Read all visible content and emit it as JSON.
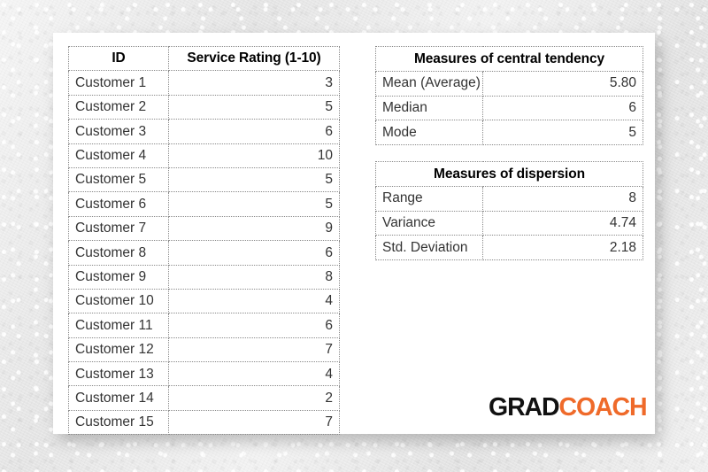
{
  "page": {
    "background_color": "#eaeaea",
    "card_color": "#ffffff"
  },
  "ratings_table": {
    "name": "service-ratings",
    "headers": [
      "ID",
      "Service Rating (1-10)"
    ],
    "rows": [
      {
        "id": "Customer 1",
        "rating": "3"
      },
      {
        "id": "Customer 2",
        "rating": "5"
      },
      {
        "id": "Customer 3",
        "rating": "6"
      },
      {
        "id": "Customer 4",
        "rating": "10"
      },
      {
        "id": "Customer 5",
        "rating": "5"
      },
      {
        "id": "Customer 6",
        "rating": "5"
      },
      {
        "id": "Customer 7",
        "rating": "9"
      },
      {
        "id": "Customer 8",
        "rating": "6"
      },
      {
        "id": "Customer 9",
        "rating": "8"
      },
      {
        "id": "Customer 10",
        "rating": "4"
      },
      {
        "id": "Customer 11",
        "rating": "6"
      },
      {
        "id": "Customer 12",
        "rating": "7"
      },
      {
        "id": "Customer 13",
        "rating": "4"
      },
      {
        "id": "Customer 14",
        "rating": "2"
      },
      {
        "id": "Customer 15",
        "rating": "7"
      }
    ]
  },
  "central_tendency_table": {
    "title": "Measures of central tendency",
    "rows": [
      {
        "label": "Mean (Average)",
        "value": "5.80"
      },
      {
        "label": "Median",
        "value": "6"
      },
      {
        "label": "Mode",
        "value": "5"
      }
    ]
  },
  "dispersion_table": {
    "title": "Measures of dispersion",
    "rows": [
      {
        "label": "Range",
        "value": "8"
      },
      {
        "label": "Variance",
        "value": "4.74"
      },
      {
        "label": "Std. Deviation",
        "value": "2.18"
      }
    ]
  },
  "logo": {
    "part1": "GRAD",
    "part2": "COACH",
    "part1_color": "#111111",
    "part2_color": "#ef6a2a"
  },
  "chart_data": {
    "type": "table",
    "title": "Service Rating (1-10) per customer with descriptive statistics",
    "categories": [
      "Customer 1",
      "Customer 2",
      "Customer 3",
      "Customer 4",
      "Customer 5",
      "Customer 6",
      "Customer 7",
      "Customer 8",
      "Customer 9",
      "Customer 10",
      "Customer 11",
      "Customer 12",
      "Customer 13",
      "Customer 14",
      "Customer 15"
    ],
    "values": [
      3,
      5,
      6,
      10,
      5,
      5,
      9,
      6,
      8,
      4,
      6,
      7,
      4,
      2,
      7
    ],
    "xlabel": "ID",
    "ylabel": "Service Rating (1-10)",
    "ylim": [
      1,
      10
    ],
    "statistics": {
      "mean": 5.8,
      "median": 6,
      "mode": 5,
      "range": 8,
      "variance": 4.74,
      "std_deviation": 2.18
    }
  }
}
